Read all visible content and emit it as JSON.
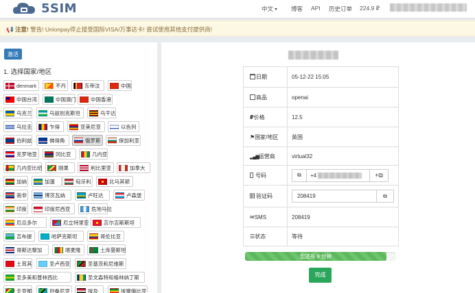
{
  "header": {
    "logo_text": "5SIM",
    "language": "中文",
    "blog": "博客",
    "api": "API",
    "order_history": "历史订单",
    "balance": "224.9 ₽"
  },
  "alert": {
    "strong": "注意!",
    "message": "警告! Unionpay停止接受国际VISA/万事达卡! 尝试使用其他支付提供商!"
  },
  "left": {
    "activate_button": "激活",
    "step_title": "1. 选择国家/地区",
    "countries": [
      {
        "name": "denmark",
        "flag": "dk"
      },
      {
        "name": "不丹",
        "flag": "bt"
      },
      {
        "name": "东帝汶",
        "flag": "tl"
      },
      {
        "name": "中国",
        "flag": "cn"
      },
      {
        "name": "中国台湾",
        "flag": "tw"
      },
      {
        "name": "中国澳门",
        "flag": "mo"
      },
      {
        "name": "中国香港",
        "flag": "hk"
      },
      {
        "name": "乌克兰",
        "flag": "ua"
      },
      {
        "name": "乌兹别克斯坦",
        "flag": "uz"
      },
      {
        "name": "乌干达",
        "flag": "ug"
      },
      {
        "name": "乌拉圭",
        "flag": "uy"
      },
      {
        "name": "乍得",
        "flag": "td"
      },
      {
        "name": "亚美尼亚",
        "flag": "am"
      },
      {
        "name": "以色列",
        "flag": "il"
      },
      {
        "name": "伯利兹",
        "flag": "bz"
      },
      {
        "name": "佛得角",
        "flag": "cv"
      },
      {
        "name": "俄罗斯",
        "flag": "ru",
        "active": true
      },
      {
        "name": "保加利亚",
        "flag": "bg"
      },
      {
        "name": "克罗地亚",
        "flag": "hr"
      },
      {
        "name": "冈比亚",
        "flag": "gm"
      },
      {
        "name": "几内亚",
        "flag": "gn"
      },
      {
        "name": "几内亚比绍",
        "flag": "gw"
      },
      {
        "name": "刚果",
        "flag": "cg"
      },
      {
        "name": "利比里亚",
        "flag": "lr"
      },
      {
        "name": "加拿大",
        "flag": "ca"
      },
      {
        "name": "加纳",
        "flag": "gh"
      },
      {
        "name": "加蓬",
        "flag": "ga"
      },
      {
        "name": "匈牙利",
        "flag": "hu"
      },
      {
        "name": "北马其顿",
        "flag": "mk"
      },
      {
        "name": "南非",
        "flag": "za"
      },
      {
        "name": "博茨瓦纳",
        "flag": "bw"
      },
      {
        "name": "卢旺达",
        "flag": "rw"
      },
      {
        "name": "卢森堡",
        "flag": "lu"
      },
      {
        "name": "印度",
        "flag": "in"
      },
      {
        "name": "印度尼西亚",
        "flag": "id"
      },
      {
        "name": "危地马拉",
        "flag": "gt"
      },
      {
        "name": "厄瓜多尔",
        "flag": "ec"
      },
      {
        "name": "厄立特里亚",
        "flag": "er"
      },
      {
        "name": "吉尔吉斯斯坦",
        "flag": "kg"
      },
      {
        "name": "吉布提",
        "flag": "dj"
      },
      {
        "name": "哈萨克斯坦",
        "flag": "kz"
      },
      {
        "name": "哥伦比亚",
        "flag": "co"
      },
      {
        "name": "哥斯达黎加",
        "flag": "cr"
      },
      {
        "name": "喀麦隆",
        "flag": "cm"
      },
      {
        "name": "土库曼斯坦",
        "flag": "tm"
      },
      {
        "name": "土耳其",
        "flag": "tr"
      },
      {
        "name": "圣卢西亚",
        "flag": "lc"
      },
      {
        "name": "圣基茨和尼维斯",
        "flag": "kn"
      },
      {
        "name": "圣多美和普林西比",
        "flag": "st"
      },
      {
        "name": "圣文森特和格林纳丁斯",
        "flag": "vc"
      },
      {
        "name": "圭亚那",
        "flag": "gy"
      },
      {
        "name": "坦桑尼亚",
        "flag": "tz"
      },
      {
        "name": "埃及",
        "flag": "eg"
      },
      {
        "name": "埃塞俄比亚",
        "flag": "et"
      }
    ]
  },
  "order": {
    "rows": {
      "date": {
        "label": "日期",
        "value": "05-12-22 15:05"
      },
      "product": {
        "label": "商品",
        "value": "openai"
      },
      "price": {
        "label": "价格",
        "value": "12.5"
      },
      "country": {
        "label": "国家/地区",
        "value": "英国"
      },
      "operator": {
        "label": "运营商",
        "value": "virtual32"
      },
      "phone": {
        "label": "号码",
        "value_prefix": "+4"
      },
      "code": {
        "label": "验证码",
        "value": "208419"
      },
      "sms": {
        "label": "SMS",
        "value": "208419"
      },
      "status": {
        "label": "状态",
        "value": "等待"
      }
    },
    "progress_text": "您还有 9 分钟",
    "progress_fraction": 0.94,
    "done_button": "完成",
    "colors": {
      "primary": "#337ab7",
      "success": "#2aa65a",
      "warning_bg": "#fcf8e3"
    }
  }
}
